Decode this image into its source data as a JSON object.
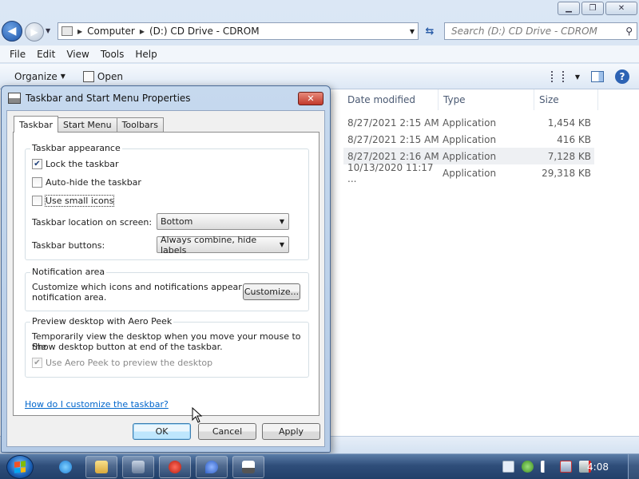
{
  "explorer": {
    "address": {
      "computer": "Computer",
      "drive": "(D:) CD Drive - CDROM"
    },
    "search_placeholder": "Search (D:) CD Drive - CDROM",
    "menu": [
      "File",
      "Edit",
      "View",
      "Tools",
      "Help"
    ],
    "commands": {
      "organize": "Organize",
      "open": "Open"
    },
    "columns": {
      "date": "Date modified",
      "type": "Type",
      "size": "Size"
    },
    "files": [
      {
        "date": "8/27/2021 2:15 AM",
        "type": "Application",
        "size": "1,454 KB"
      },
      {
        "date": "8/27/2021 2:15 AM",
        "type": "Application",
        "size": "416 KB"
      },
      {
        "date": "8/27/2021 2:16 AM",
        "type": "Application",
        "size": "7,128 KB"
      },
      {
        "date": "10/13/2020 11:17 ...",
        "type": "Application",
        "size": "29,318 KB"
      }
    ]
  },
  "dialog": {
    "title": "Taskbar and Start Menu Properties",
    "tabs": [
      "Taskbar",
      "Start Menu",
      "Toolbars"
    ],
    "appearance": {
      "title": "Taskbar appearance",
      "lock": "Lock the taskbar",
      "lock_checked": true,
      "autohide": "Auto-hide the taskbar",
      "small_icons": "Use small icons",
      "location_label": "Taskbar location on screen:",
      "location_value": "Bottom",
      "buttons_label": "Taskbar buttons:",
      "buttons_value": "Always combine, hide labels"
    },
    "notification": {
      "title": "Notification area",
      "desc_line1": "Customize which icons and notifications appear in the",
      "desc_line2": "notification area.",
      "customize": "Customize..."
    },
    "aero_peek": {
      "title": "Preview desktop with Aero Peek",
      "desc_line1": "Temporarily view the desktop when you move your mouse to the",
      "desc_line2": "Show desktop button at end of the taskbar.",
      "use": "Use Aero Peek to preview the desktop"
    },
    "help_link": "How do I customize the taskbar?",
    "buttons": {
      "ok": "OK",
      "cancel": "Cancel",
      "apply": "Apply"
    }
  },
  "taskbar": {
    "clock": "4:08"
  }
}
